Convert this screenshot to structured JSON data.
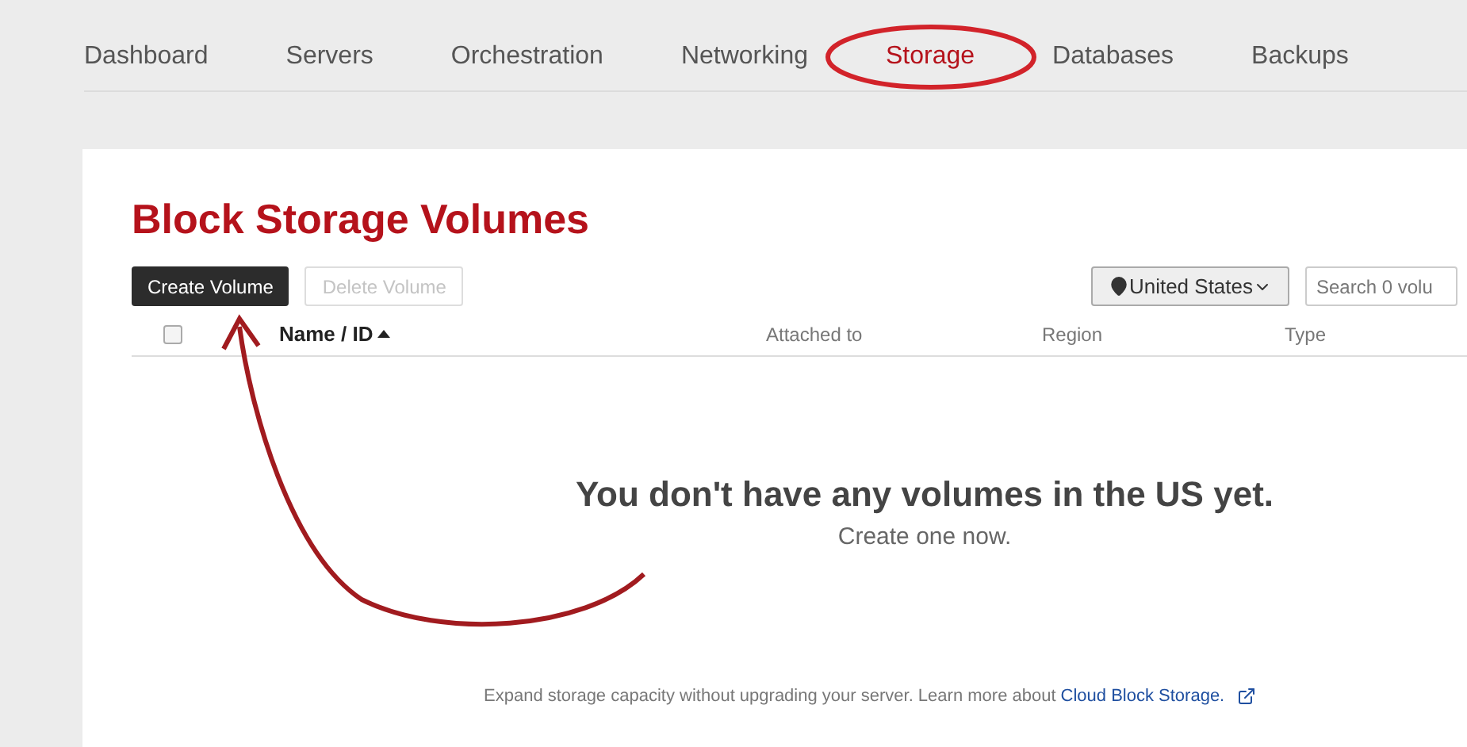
{
  "nav": [
    {
      "label": "Dashboard",
      "selected": false
    },
    {
      "label": "Servers",
      "selected": false
    },
    {
      "label": "Orchestration",
      "selected": false
    },
    {
      "label": "Networking",
      "selected": false
    },
    {
      "label": "Storage",
      "selected": true
    },
    {
      "label": "Databases",
      "selected": false
    },
    {
      "label": "Backups",
      "selected": false
    }
  ],
  "title": "Block Storage Volumes",
  "buttons": [
    {
      "label": "Create Volume",
      "disabled": false
    },
    {
      "label": "Delete Volume",
      "disabled": true
    }
  ],
  "region_select": "United States",
  "search": {
    "placeholder": "Search 0 volu"
  },
  "table": {
    "select_all_checked": false,
    "columns": [
      {
        "label": "Name / ID",
        "sorted": true
      },
      {
        "label": "Attached to",
        "sorted": false
      },
      {
        "label": "Region",
        "sorted": false
      },
      {
        "label": "Type",
        "sorted": false
      }
    ]
  },
  "empty_state": {
    "heading": "You don't have any volumes in the US yet.",
    "link": "Create one now."
  },
  "footer": {
    "text": "Expand storage capacity without upgrading your server. Learn more about",
    "link": "Cloud Block Storage."
  }
}
